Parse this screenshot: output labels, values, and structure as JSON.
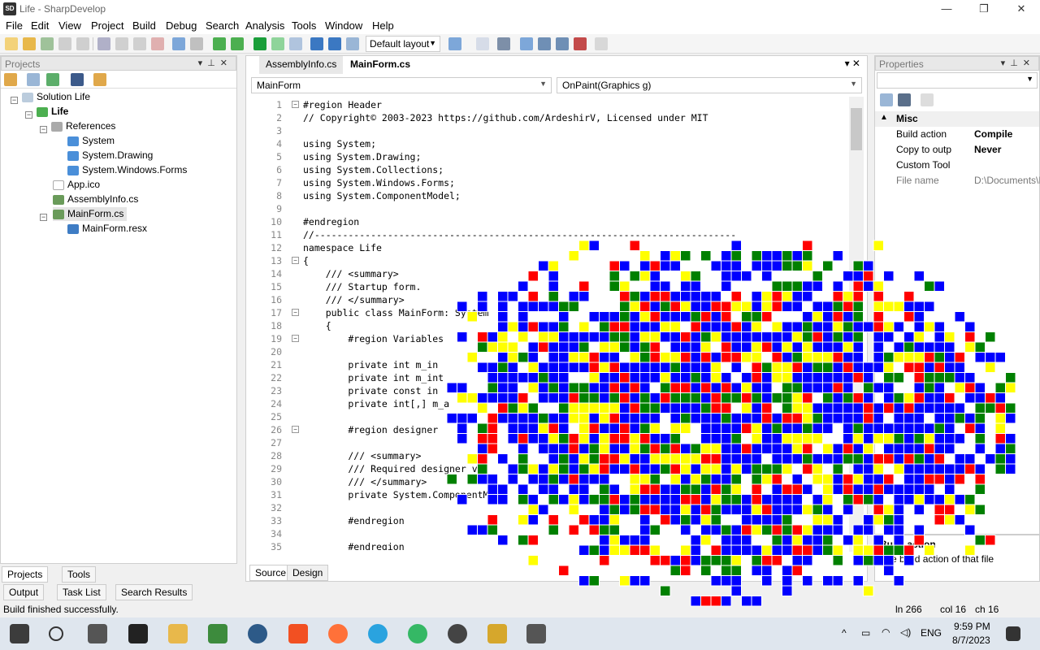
{
  "window": {
    "title": "Life - SharpDevelop",
    "app_icon": "SD",
    "minimize": "—",
    "restore": "❐",
    "close": "✕"
  },
  "menu": [
    "File",
    "Edit",
    "View",
    "Project",
    "Build",
    "Debug",
    "Search",
    "Analysis",
    "Tools",
    "Window",
    "Help"
  ],
  "toolbar": {
    "layout": "Default layout"
  },
  "projects": {
    "header": "Projects",
    "tree": [
      {
        "label": "Solution Life",
        "bold": false
      },
      {
        "label": "Life",
        "bold": true
      },
      {
        "label": "References",
        "bold": false
      },
      {
        "label": "System",
        "bold": false
      },
      {
        "label": "System.Drawing",
        "bold": false
      },
      {
        "label": "System.Windows.Forms",
        "bold": false
      },
      {
        "label": "App.ico",
        "bold": false
      },
      {
        "label": "AssemblyInfo.cs",
        "bold": false
      },
      {
        "label": "MainForm.cs",
        "bold": false
      },
      {
        "label": "MainForm.resx",
        "bold": false
      }
    ],
    "tabs": [
      "Projects",
      "Tools"
    ]
  },
  "bottom_tabs": [
    "Output",
    "Task List",
    "Search Results"
  ],
  "editor": {
    "tabs": [
      "AssemblyInfo.cs",
      "MainForm.cs"
    ],
    "class_combo": "MainForm",
    "member_combo": "OnPaint(Graphics g)",
    "lines": [
      {
        "n": "1",
        "t": "#region Header"
      },
      {
        "n": "2",
        "t": "// Copyright© 2003-2023 https://github.com/ArdeshirV, Licensed under MIT"
      },
      {
        "n": "3",
        "t": ""
      },
      {
        "n": "4",
        "t": "using System;"
      },
      {
        "n": "5",
        "t": "using System.Drawing;"
      },
      {
        "n": "6",
        "t": "using System.Collections;"
      },
      {
        "n": "7",
        "t": "using System.Windows.Forms;"
      },
      {
        "n": "8",
        "t": "using System.ComponentModel;"
      },
      {
        "n": "9",
        "t": ""
      },
      {
        "n": "10",
        "t": "#endregion"
      },
      {
        "n": "11",
        "t": "//---------------------------------------------------------------------------"
      },
      {
        "n": "12",
        "t": "namespace Life"
      },
      {
        "n": "13",
        "t": "{"
      },
      {
        "n": "14",
        "t": "    /// <summary>"
      },
      {
        "n": "15",
        "t": "    /// Startup form."
      },
      {
        "n": "16",
        "t": "    /// </summary>"
      },
      {
        "n": "17",
        "t": "    public class MainForm: System"
      },
      {
        "n": "18",
        "t": "    {"
      },
      {
        "n": "19",
        "t": "        #region Variables"
      },
      {
        "n": "20",
        "t": ""
      },
      {
        "n": "21",
        "t": "        private int m_in"
      },
      {
        "n": "22",
        "t": "        private int m_int"
      },
      {
        "n": "23",
        "t": "        private const in"
      },
      {
        "n": "24",
        "t": "        private int[,] m_a"
      },
      {
        "n": "25",
        "t": ""
      },
      {
        "n": "26",
        "t": "        #region designer"
      },
      {
        "n": "27",
        "t": ""
      },
      {
        "n": "28",
        "t": "        /// <summary>"
      },
      {
        "n": "29",
        "t": "        /// Required designer v"
      },
      {
        "n": "30",
        "t": "        /// </summary>"
      },
      {
        "n": "31",
        "t": "        private System.ComponentMo"
      },
      {
        "n": "32",
        "t": ""
      },
      {
        "n": "33",
        "t": "        #endregion"
      },
      {
        "n": "34",
        "t": ""
      },
      {
        "n": "35",
        "t": "        #endregion"
      }
    ],
    "source_tabs": [
      "Source",
      "Design"
    ]
  },
  "properties": {
    "header": "Properties",
    "category": "Misc",
    "rows": [
      {
        "name": "Build action",
        "value": "Compile"
      },
      {
        "name": "Copy to outp",
        "value": "Never"
      },
      {
        "name": "Custom Tool",
        "value": ""
      },
      {
        "name": "File name",
        "value": "D:\\Documents\\Proje"
      }
    ],
    "desc_title": "Build action",
    "desc_text": "The build action of that file"
  },
  "status": {
    "message": "Build finished successfully.",
    "ln": "ln 266",
    "col": "col 16",
    "ch": "ch 16"
  },
  "taskbar": {
    "time": "9:59 PM",
    "date": "8/7/2023",
    "lang": "ENG"
  },
  "colors": {
    "blue": "#0000ff",
    "red": "#ff0000",
    "yellow": "#ffff00",
    "green": "#008000",
    "keyword": "#008000"
  }
}
